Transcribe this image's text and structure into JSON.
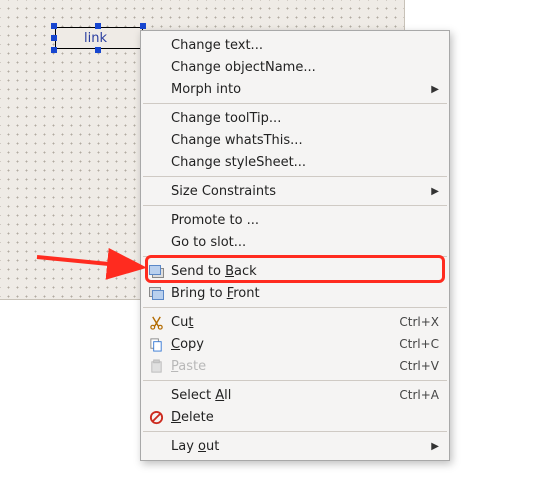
{
  "widget": {
    "text": "link"
  },
  "menu": {
    "change_text": "Change text...",
    "change_objectname": "Change objectName...",
    "morph_into": "Morph into",
    "change_tooltip": "Change toolTip...",
    "change_whatsthis": "Change whatsThis...",
    "change_stylesheet": "Change styleSheet...",
    "size_constraints": "Size Constraints",
    "promote_to": "Promote to ...",
    "go_to_slot": "Go to slot...",
    "send_to_back": "Send to Back",
    "bring_to_front": "Bring to Front",
    "cut": "Cut",
    "copy": "Copy",
    "paste": "Paste",
    "select_all": "Select All",
    "delete": "Delete",
    "lay_out": "Lay out",
    "shortcut_cut": "Ctrl+X",
    "shortcut_copy": "Ctrl+C",
    "shortcut_paste": "Ctrl+V",
    "shortcut_select_all": "Ctrl+A"
  }
}
